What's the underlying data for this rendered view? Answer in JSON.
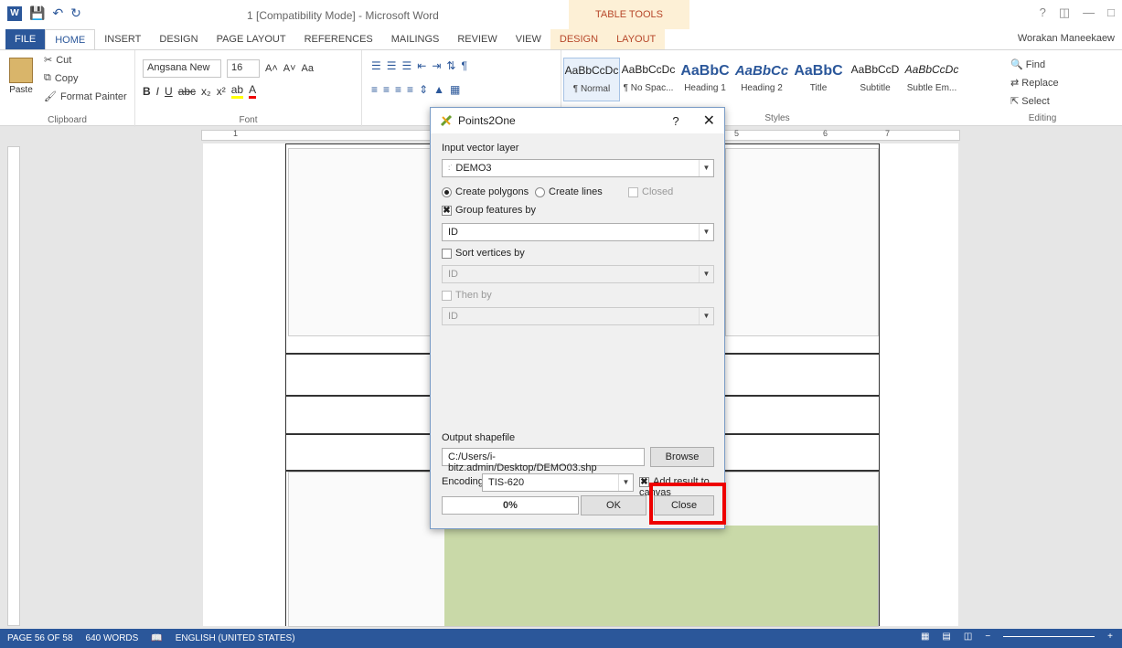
{
  "window": {
    "title": "1 [Compatibility Mode] - Microsoft Word",
    "table_tools": "TABLE TOOLS",
    "user": "Worakan Maneekaew"
  },
  "tabs": [
    "FILE",
    "HOME",
    "INSERT",
    "DESIGN",
    "PAGE LAYOUT",
    "REFERENCES",
    "MAILINGS",
    "REVIEW",
    "VIEW",
    "DESIGN",
    "LAYOUT"
  ],
  "ribbon": {
    "clipboard": {
      "cut": "Cut",
      "copy": "Copy",
      "paste": "Paste",
      "format_painter": "Format Painter",
      "label": "Clipboard"
    },
    "font": {
      "name": "Angsana New",
      "size": "16",
      "label": "Font"
    },
    "styles": {
      "label": "Styles",
      "items": [
        {
          "preview": "AaBbCcDc",
          "name": "¶ Normal"
        },
        {
          "preview": "AaBbCcDc",
          "name": "¶ No Spac..."
        },
        {
          "preview": "AaBbC",
          "name": "Heading 1"
        },
        {
          "preview": "AaBbCc",
          "name": "Heading 2"
        },
        {
          "preview": "AaBbC",
          "name": "Title"
        },
        {
          "preview": "AaBbCcD",
          "name": "Subtitle"
        },
        {
          "preview": "AaBbCcDc",
          "name": "Subtle Em..."
        }
      ]
    },
    "editing": {
      "find": "Find",
      "replace": "Replace",
      "select": "Select",
      "label": "Editing"
    }
  },
  "dialog": {
    "title": "Points2One",
    "help": "?",
    "input_label": "Input vector layer",
    "input_value": "DEMO3",
    "create_polygons": "Create polygons",
    "create_lines": "Create lines",
    "closed": "Closed",
    "group_features": "Group features by",
    "group_value": "ID",
    "sort_vertices": "Sort vertices by",
    "sort_value": "ID",
    "then_by": "Then by",
    "then_value": "ID",
    "output_label": "Output shapefile",
    "output_path": "C:/Users/i-bitz.admin/Desktop/DEMO03.shp",
    "browse": "Browse",
    "encoding_label": "Encoding",
    "encoding_value": "TIS-620",
    "add_result": "Add result to canvas",
    "progress_text": "0%",
    "progress_value": 0,
    "ok": "OK",
    "close": "Close"
  },
  "ruler": [
    "1",
    "5",
    "6",
    "7"
  ],
  "status": {
    "page": "PAGE 56 OF 58",
    "words": "640 WORDS",
    "language": "ENGLISH (UNITED STATES)"
  }
}
